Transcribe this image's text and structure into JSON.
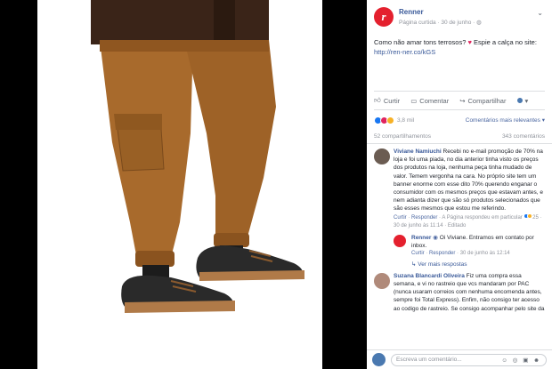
{
  "page": {
    "name": "Renner",
    "logo_letter": "r",
    "meta": "Página curtida · 30 de junho · ",
    "globe_icon": "globe-icon"
  },
  "post": {
    "text": "Como não amar tons terrosos?",
    "text2": "Espie a calça no site:",
    "link": "http://ren-ner.co/kGS"
  },
  "actions": {
    "like": "Curtir",
    "comment": "Comentar",
    "share": "Compartilhar"
  },
  "reactions": {
    "count": "3,8 mil",
    "sort_label": "Comentários mais relevantes ▾"
  },
  "counts": {
    "shares": "52 compartilhamentos",
    "comments": "343 comentários"
  },
  "comments": [
    {
      "name": "Viviane Namiuchi",
      "text": "Recebi no e-mail promoção de 70% na loja e foi uma piada, no dia anterior tinha visto os preços dos produtos na loja, nenhuma peça tinha mudado de valor. Temem vergonha na cara. No próprio site tem um banner enorme com esse dito 70% querendo enganar o consumidor com os mesmos preços que estavam antes, e nem adianta dizer que são só produtos selecionados que são esses mesmos que estou me referindo.",
      "meta_like": "Curtir",
      "meta_reply": "Responder",
      "meta_replied": "A Página respondeu em particular",
      "meta_rest": "25 · 30 de junho às 11:14 · Editado",
      "reply": {
        "name": "Renner",
        "text": "Oi Viviane. Entramos em contato por inbox.",
        "meta_like": "Curtir",
        "meta_reply": "Responder",
        "meta_time": "30 de junho às 12:14"
      },
      "more_replies": "Ver mais respostas"
    },
    {
      "name": "Suzana Blancardi Oliveira",
      "text": "Fiz uma compra essa semana, e vi no rastreio que vcs mandaram por PAC (nunca usaram correios com nenhuma encomenda antes, sempre foi Total Express). Enfim, não consigo ter acesso ao codigo de rastreio. Se consigo acompanhar pelo site da"
    }
  ],
  "compose": {
    "placeholder": "Escreva um comentário...",
    "icons": "☺ ◎ ▣ ☻"
  },
  "colors": {
    "brand_red": "#e4202e",
    "link_blue": "#385898",
    "pants": "#a86a2c"
  }
}
